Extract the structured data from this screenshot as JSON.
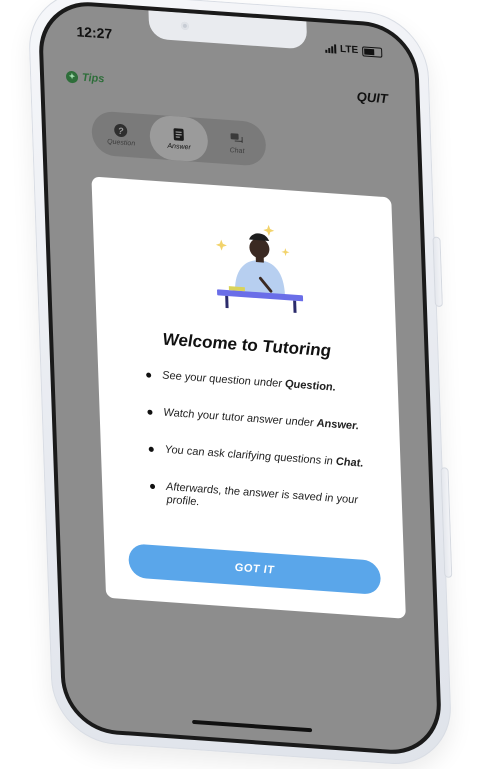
{
  "status_bar": {
    "time": "12:27",
    "network": "LTE"
  },
  "header": {
    "tips_label": "Tips",
    "quit_label": "QUIT"
  },
  "tabs": [
    {
      "label": "Question",
      "icon": "question-icon"
    },
    {
      "label": "Answer",
      "icon": "document-icon",
      "active": true
    },
    {
      "label": "Chat",
      "icon": "chat-icon"
    }
  ],
  "modal": {
    "title": "Welcome to Tutoring",
    "items": [
      {
        "text": "See your question under ",
        "emphasis": "Question."
      },
      {
        "text": "Watch your tutor answer under ",
        "emphasis": "Answer."
      },
      {
        "text": "You can ask clarifying questions in ",
        "emphasis": "Chat."
      },
      {
        "text": "Afterwards, the answer is saved in your profile.",
        "emphasis": ""
      }
    ],
    "button_label": "GOT IT"
  },
  "colors": {
    "screen_overlay": "#8d8d8d",
    "button": "#5aa6ea",
    "tips_green": "#2e6e3a"
  }
}
